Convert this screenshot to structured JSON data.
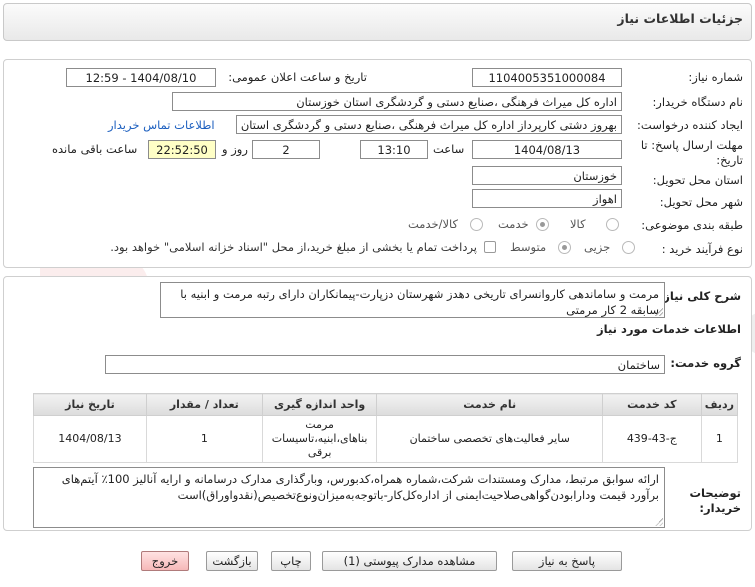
{
  "header": {
    "title": "جزئیات اطلاعات نیاز"
  },
  "need": {
    "number_label": "شماره نیاز:",
    "number": "1104005351000084",
    "announce_label": "تاریخ و ساعت اعلان عمومی:",
    "announce_value": "1404/08/10 - 12:59",
    "buyer_org_label": "نام دستگاه خریدار:",
    "buyer_org": "اداره کل میراث فرهنگی ،صنایع دستی و گردشگری استان خوزستان",
    "requester_label": "ایجاد کننده درخواست:",
    "requester": "بهروز دشتی کارپرداز اداره کل میراث فرهنگی ،صنایع دستی و گردشگری استان خوزستان",
    "contact_link": "اطلاعات تماس خریدار",
    "deadline_label_1": "مهلت ارسال پاسخ: تا",
    "deadline_label_2": "تاریخ:",
    "deadline_date": "1404/08/13",
    "time_label": "ساعت",
    "deadline_time": "13:10",
    "days_value": "2",
    "days_label": "روز و",
    "remaining_time": "22:52:50",
    "remaining_label": "ساعت باقی مانده",
    "province_label": "استان محل تحویل:",
    "province": "خوزستان",
    "city_label": "شهر محل تحویل:",
    "city": "اهواز",
    "category_label": "طبقه بندی موضوعی:",
    "category_options": [
      "کالا",
      "خدمت",
      "کالا/خدمت"
    ],
    "category_selected": "خدمت",
    "process_label": "نوع فرآیند خرید :",
    "process_options": [
      "جزیی",
      "متوسط"
    ],
    "process_selected": "متوسط",
    "payment_note": "پرداخت تمام یا بخشی از مبلغ خرید،از محل \"اسناد خزانه اسلامی\" خواهد بود."
  },
  "summary": {
    "label": "شرح کلی نیاز:",
    "text": "مرمت و ساماندهی کاروانسرای تاریخی دهدز شهرستان دزپارت-پیمانکاران دارای رتبه مرمت و ابنیه با سابقه 2 کار مرمتی"
  },
  "services": {
    "section_title": "اطلاعات خدمات مورد نیاز",
    "group_label": "گروه خدمت:",
    "group_value": "ساختمان",
    "columns": [
      "ردیف",
      "کد خدمت",
      "نام خدمت",
      "واحد اندازه گیری",
      "تعداد / مقدار",
      "تاریخ نیاز"
    ],
    "rows": [
      {
        "row": "1",
        "code": "ج-43-439",
        "name": "سایر فعالیت‌های تخصصی ساختمان",
        "unit": "مرمت بناهای،ابنیه،تاسیسات برقی",
        "qty": "1",
        "date": "1404/08/13"
      }
    ]
  },
  "buyer_notes": {
    "label_1": "توضیحات",
    "label_2": "خریدار:",
    "text": "ارائه سوابق مرتبط، مدارک ومستندات شرکت،شماره همراه،کدبورس، وبارگذاری مدارک درسامانه و ارایه آنالیز 100٪ آیتم‌های برآورد قیمت ودارابودن‌گواهی‌صلاحیت‌ایمنی از اداره‌کل‌کار-باتوجه‌به‌میزان‌ونوع‌تخصیص(نقدواوراق)است"
  },
  "buttons": {
    "reply": "پاسخ به نیاز",
    "attachments": "مشاهده مدارک پیوستی (1)",
    "print": "چاپ",
    "back": "بازگشت",
    "exit": "خروج"
  },
  "colors": {
    "link": "#1c5fbf",
    "remaining_bg": "#ffffc6",
    "exit_bg": "#f6b9b9",
    "watermark": "#d9534f"
  },
  "watermark": {
    "text": "AriaTender.net"
  }
}
